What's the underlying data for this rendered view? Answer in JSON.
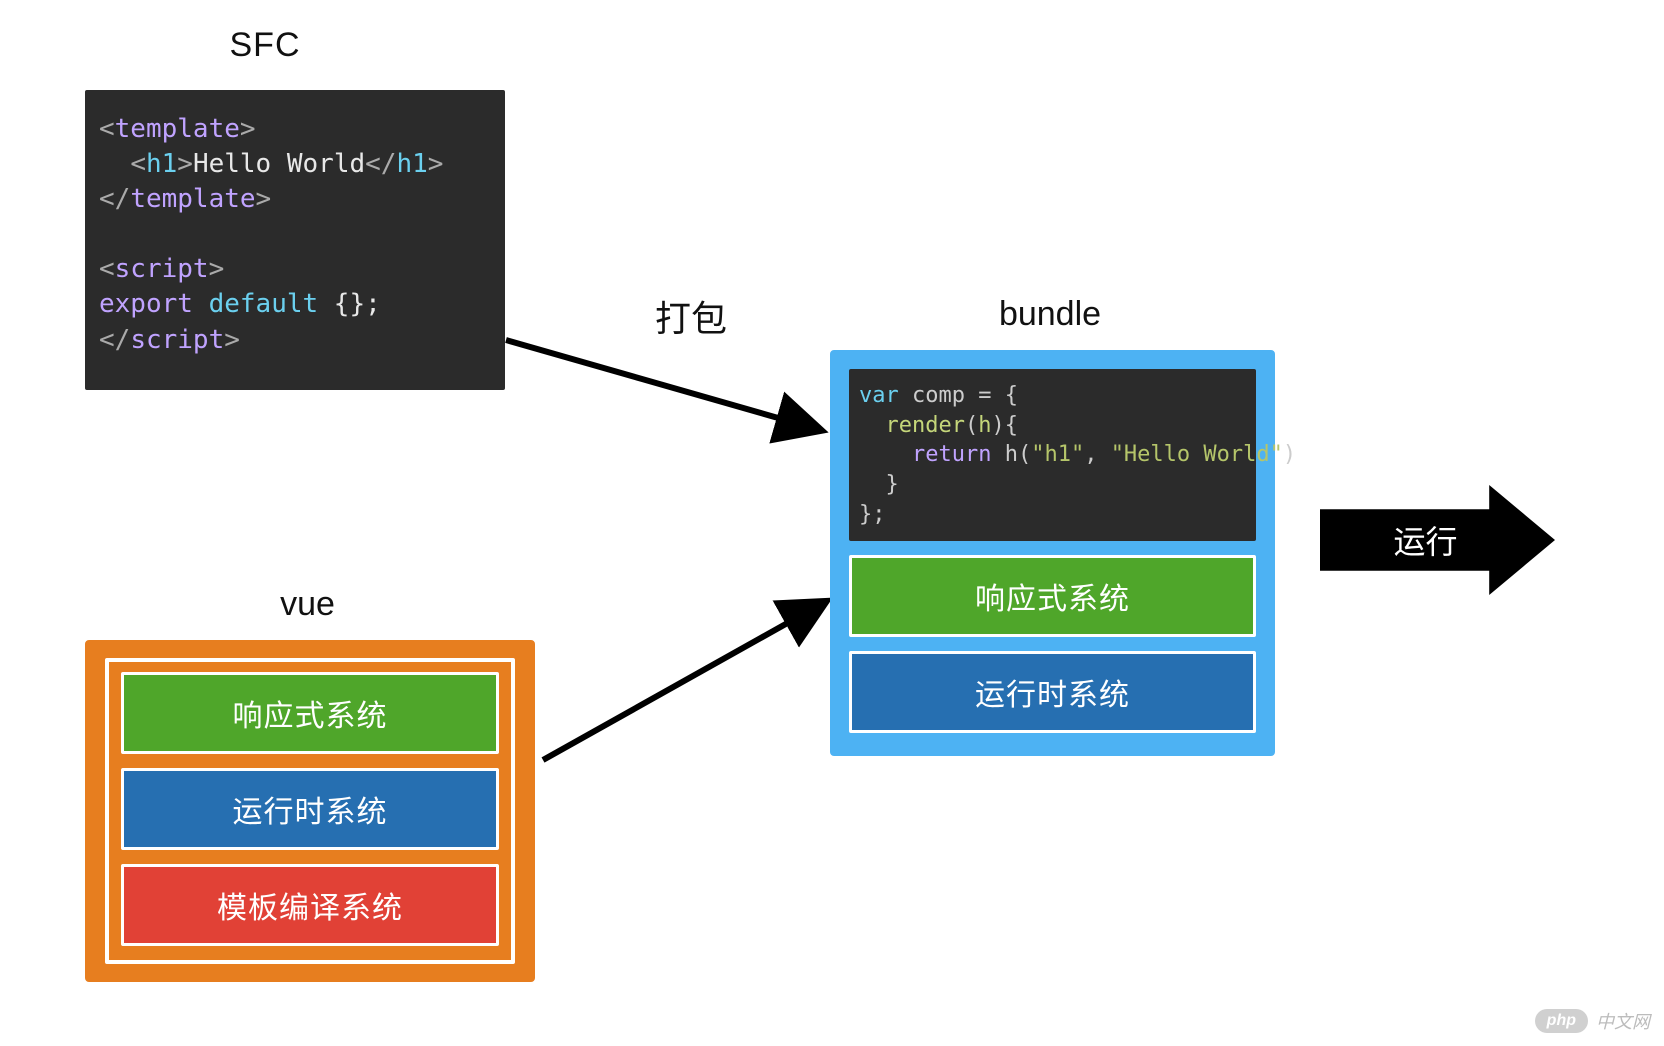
{
  "sfc": {
    "label": "SFC",
    "code": {
      "tpl_open": "template",
      "h1_open": "h1",
      "text": "Hello World",
      "h1_close": "h1",
      "tpl_close": "template",
      "script_open": "script",
      "export_kw": "export",
      "default_kw": "default",
      "obj": " {};",
      "script_close": "script"
    }
  },
  "vue": {
    "label": "vue",
    "items": [
      {
        "label": "响应式系统"
      },
      {
        "label": "运行时系统"
      },
      {
        "label": "模板编译系统"
      }
    ]
  },
  "pack_label": "打包",
  "bundle": {
    "label": "bundle",
    "code": {
      "l1a": "var",
      "l1b": " comp = {",
      "l2a": "  render",
      "l2b": "(",
      "l2c": "h",
      "l2d": "){",
      "l3a": "    return",
      "l3b": " h(",
      "l3c": "\"h1\"",
      "l3d": ", ",
      "l3e": "\"Hello World\"",
      "l3f": ")",
      "l4": "  }",
      "l5": "};"
    },
    "items": [
      {
        "label": "响应式系统"
      },
      {
        "label": "运行时系统"
      }
    ]
  },
  "run_label": "运行",
  "watermark": {
    "badge": "php",
    "text": "中文网"
  }
}
